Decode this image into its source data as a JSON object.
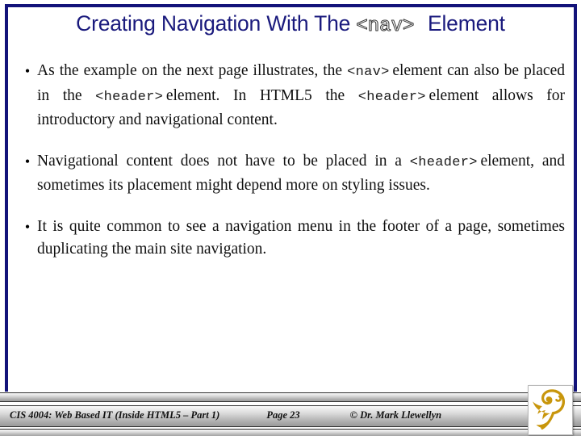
{
  "slide": {
    "background_color": "#ffffff",
    "frame_color": "#13137a",
    "title_color": "#1a1a7d"
  },
  "title": {
    "part1": "Creating Navigation With The ",
    "code": "<nav>",
    "part2": " Element"
  },
  "bullets": [
    {
      "marker": "•",
      "segments": [
        {
          "type": "text",
          "value": "As the example on the next page illustrates, the "
        },
        {
          "type": "code",
          "value": "<nav>"
        },
        {
          "type": "text",
          "value": "element can also be placed in the "
        },
        {
          "type": "code",
          "value": "<header>"
        },
        {
          "type": "text",
          "value": "element.  In HTML5 the "
        },
        {
          "type": "code",
          "value": "<header>"
        },
        {
          "type": "text",
          "value": "element allows for introductory and navigational content."
        }
      ]
    },
    {
      "marker": "•",
      "segments": [
        {
          "type": "text",
          "value": "Navigational content does not have to be placed in a "
        },
        {
          "type": "code",
          "value": "<header>"
        },
        {
          "type": "text",
          "value": "element, and sometimes its placement might depend more on styling issues."
        }
      ]
    },
    {
      "marker": "•",
      "segments": [
        {
          "type": "text",
          "value": "It is quite common to see a navigation menu in the footer of a page, sometimes duplicating the main site navigation."
        }
      ]
    }
  ],
  "footer": {
    "course": "CIS 4004: Web Based IT (Inside HTML5 – Part 1)",
    "page": "Page 23",
    "author": "© Dr. Mark Llewellyn",
    "logo_name": "ucf-pegasus-logo",
    "logo_color": "#c8960c"
  }
}
